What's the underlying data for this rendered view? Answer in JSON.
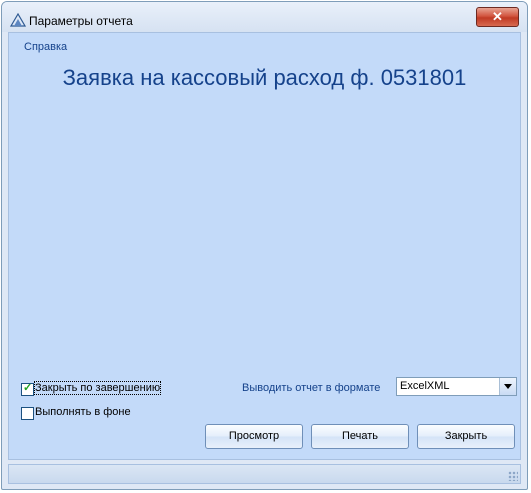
{
  "window": {
    "title": "Параметры отчета",
    "close_symbol": "✕"
  },
  "menu": {
    "help_label": "Справка"
  },
  "report": {
    "title": "Заявка на кассовый расход ф. 0531801"
  },
  "options": {
    "close_on_complete_label": "Закрыть по завершению",
    "close_on_complete_checked": true,
    "run_in_background_label": "Выполнять в фоне",
    "run_in_background_checked": false,
    "format_label": "Выводить отчет в формате",
    "format_value": "ExcelXML"
  },
  "buttons": {
    "preview_label": "Просмотр",
    "print_label": "Печать",
    "close_label": "Закрыть"
  },
  "icons": {
    "app": "report-app-icon",
    "close": "close-icon",
    "dropdown": "chevron-down-icon",
    "check": "checkmark-icon",
    "grip": "resize-grip-icon"
  }
}
